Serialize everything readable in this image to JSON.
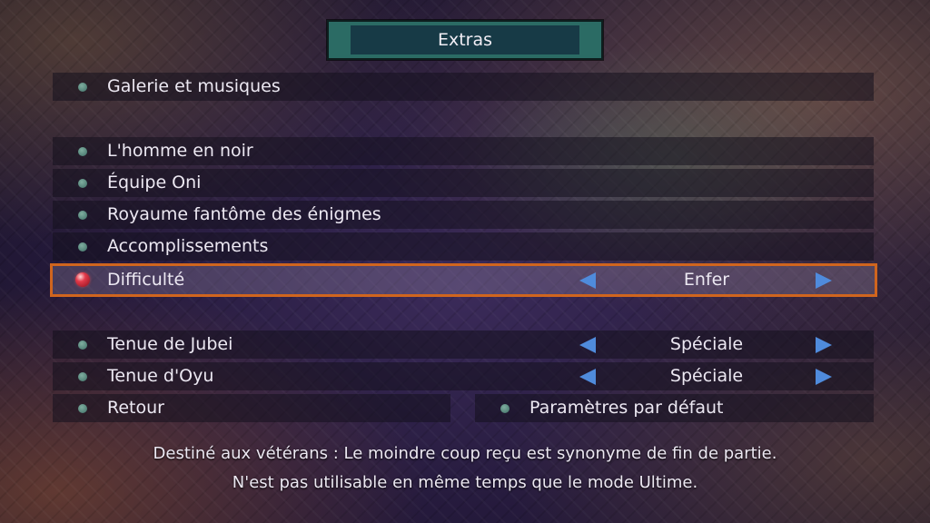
{
  "header": {
    "title": "Extras"
  },
  "menu": {
    "gallery": "Galerie et musiques",
    "man_in_black": "L'homme en noir",
    "oni_team": "Équipe Oni",
    "riddle_kingdom": "Royaume fantôme des énigmes",
    "achievements": "Accomplissements",
    "difficulty": {
      "label": "Difficulté",
      "value": "Enfer"
    },
    "jubei_outfit": {
      "label": "Tenue de Jubei",
      "value": "Spéciale"
    },
    "oyu_outfit": {
      "label": "Tenue d'Oyu",
      "value": "Spéciale"
    },
    "back": "Retour",
    "defaults": "Paramètres par défaut"
  },
  "help": {
    "line1": "Destiné aux vétérans : Le moindre coup reçu est synonyme de fin de partie.",
    "line2": "N'est pas utilisable en même temps que le mode Ultime."
  },
  "colors": {
    "selection_border": "#d0651e",
    "arrow": "#4f8bdc",
    "title_frame": "#2b6b64",
    "title_fill": "#173a46"
  },
  "icons": {
    "bullet": "bullet-icon",
    "selected_bullet": "selected-bullet-icon",
    "left_arrow": "arrow-left-icon",
    "right_arrow": "arrow-right-icon"
  }
}
